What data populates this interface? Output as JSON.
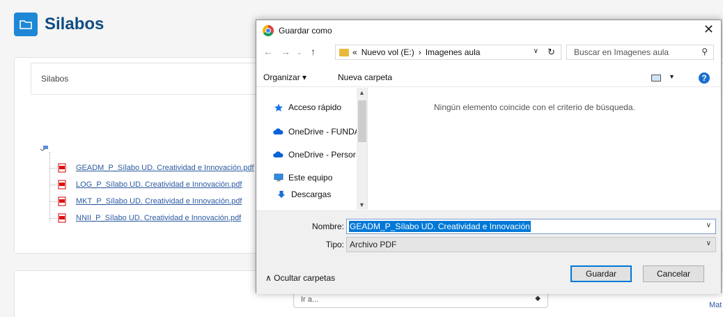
{
  "page": {
    "title": "Silabos",
    "breadcrumb": "Silabos",
    "files": [
      "GEADM_P_Sílabo UD. Creatividad e Innovación.pdf",
      "LOG_P_Sílabo UD. Creatividad e Innovación.pdf",
      "MKT_P_Sílabo UD. Creatividad e Innovación.pdf",
      "NNII_P_Sílabo UD. Creatividad e Innovación.pdf"
    ],
    "goto_placeholder": "Ir a...",
    "side_link": "Mat"
  },
  "dialog": {
    "title": "Guardar como",
    "path": [
      "«",
      "Nuevo vol (E:)",
      "›",
      "Imagenes aula"
    ],
    "search_placeholder": "Buscar en Imagenes aula",
    "toolbar": {
      "organize": "Organizar ▾",
      "new_folder": "Nueva carpeta"
    },
    "nav_items": [
      "Acceso rápido",
      "OneDrive - FUNDA",
      "OneDrive - Persor",
      "Este equipo",
      "Descargas"
    ],
    "empty_message": "Ningún elemento coincide con el criterio de búsqueda.",
    "name_label": "Nombre:",
    "name_value": "GEADM_P_Sílabo UD. Creatividad e Innovación",
    "type_label": "Tipo:",
    "type_value": "Archivo PDF",
    "hide_folders": "Ocultar carpetas",
    "save_button": "Guardar",
    "cancel_button": "Cancelar"
  }
}
